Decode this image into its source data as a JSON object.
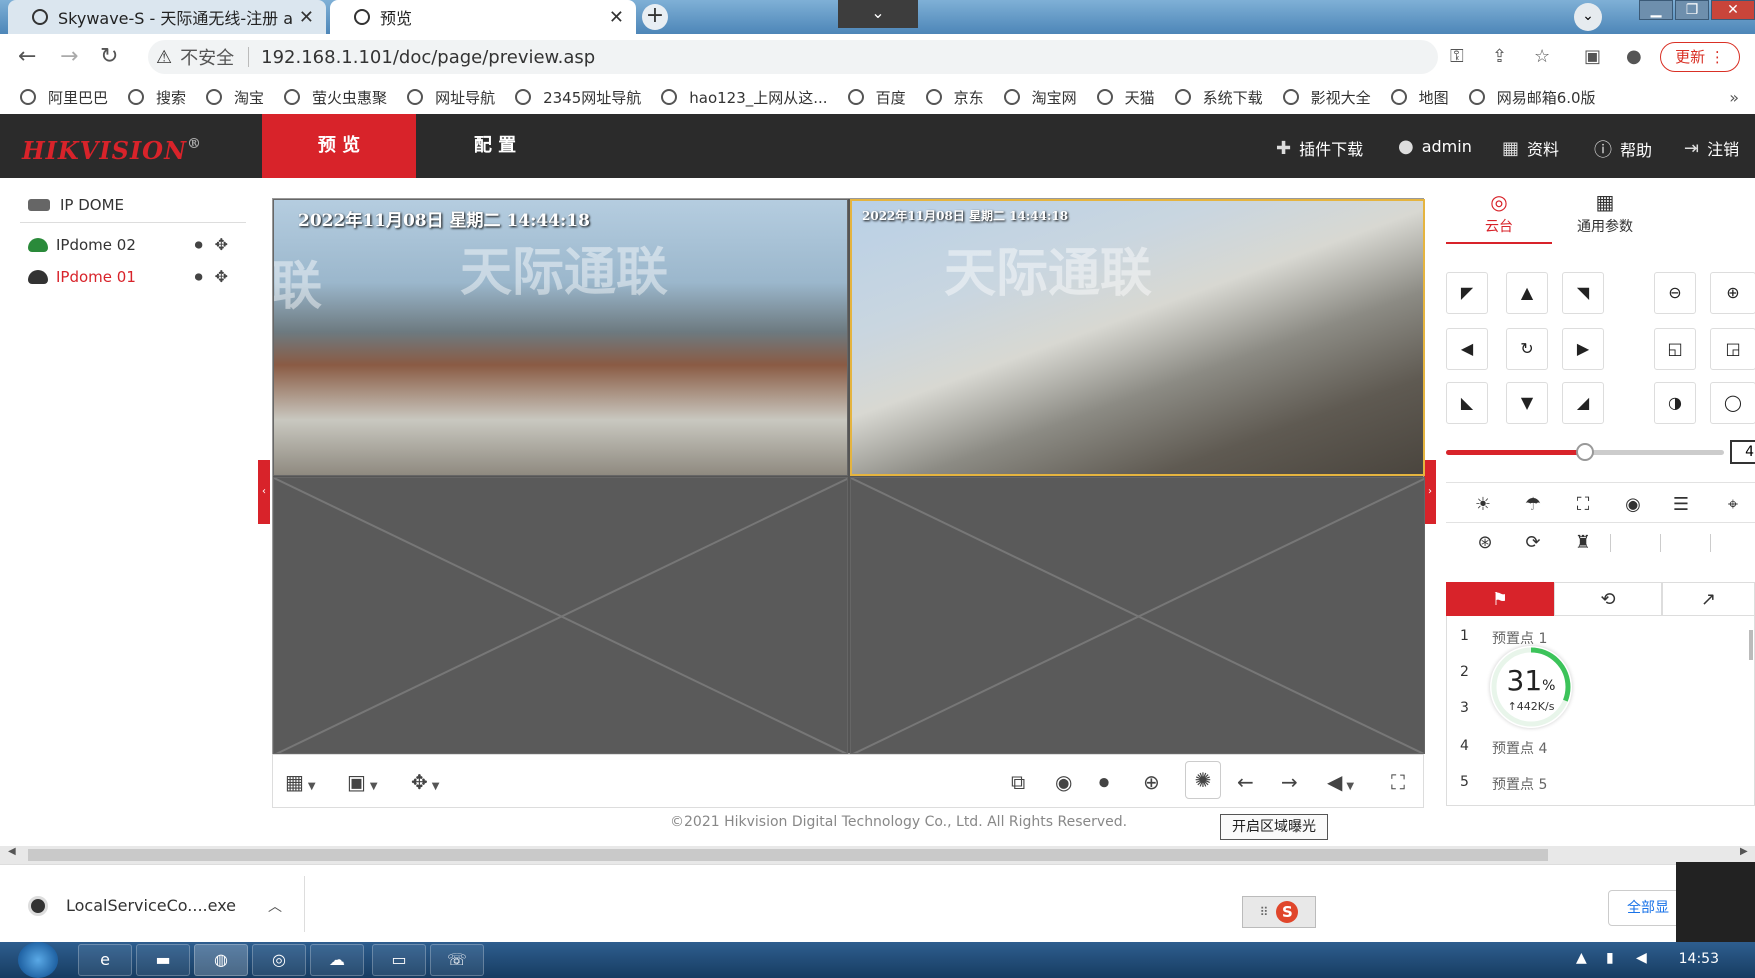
{
  "browser": {
    "tabs": [
      {
        "title": "Skywave-S - 天际通无线-注册 a",
        "close": "✕"
      },
      {
        "title": "预览",
        "close": "✕"
      }
    ],
    "new_tab": "+",
    "tab_dropdown": "⌄",
    "address": {
      "insecure_label": "不安全",
      "url": "192.168.1.101/doc/page/preview.asp"
    },
    "update_label": "更新",
    "bookmarks": [
      "阿里巴巴",
      "搜索",
      "淘宝",
      "萤火虫惠聚",
      "网址导航",
      "2345网址导航",
      "hao123_上网从这...",
      "百度",
      "京东",
      "淘宝网",
      "天猫",
      "系统下载",
      "影视大全",
      "地图",
      "网易邮箱6.0版"
    ],
    "bookmarks_more": "»"
  },
  "app": {
    "brand": "HIKVISION",
    "brand_mark": "®",
    "nav": {
      "preview": "预 览",
      "config": "配 置"
    },
    "header_links": {
      "plugin": "插件下载",
      "user": "admin",
      "info": "资料",
      "help": "帮助",
      "logout": "注销"
    }
  },
  "tree": {
    "root": "IP DOME",
    "devices": [
      {
        "name": "IPdome 02",
        "status": "online"
      },
      {
        "name": "IPdome 01",
        "status": "offline"
      }
    ]
  },
  "video": {
    "osd": [
      "2022年11月08日  星期二  14:44:18",
      "2022年11月08日  星期二  14:44:18"
    ],
    "watermark": "天际通联",
    "watermark_partial": "联"
  },
  "toolbar": {
    "tooltip": "开启区域曝光"
  },
  "footer": {
    "copyright": "©2021 Hikvision Digital Technology Co., Ltd. All Rights Reserved."
  },
  "ptz": {
    "tabs": {
      "ptz": "云台",
      "common": "通用参数"
    },
    "speed_value": "4",
    "speed_level": 0.5,
    "presets": [
      {
        "num": "1",
        "name": "预置点 1"
      },
      {
        "num": "2",
        "name": ""
      },
      {
        "num": "3",
        "name": ""
      },
      {
        "num": "4",
        "name": "预置点 4"
      },
      {
        "num": "5",
        "name": "预置点 5"
      }
    ]
  },
  "net_monitor": {
    "percent": "31",
    "percent_sign": "%",
    "rate": "↑442K/s",
    "level": 0.31
  },
  "downloads": {
    "file": "LocalServiceCo....exe",
    "show_all": "全部显"
  },
  "taskbar": {
    "clock": "14:53"
  },
  "colors": {
    "brand_red": "#d8232a",
    "header_bg": "#2b2b2b",
    "gauge_green": "#3cc35a",
    "selected_border": "#e5b43f"
  }
}
